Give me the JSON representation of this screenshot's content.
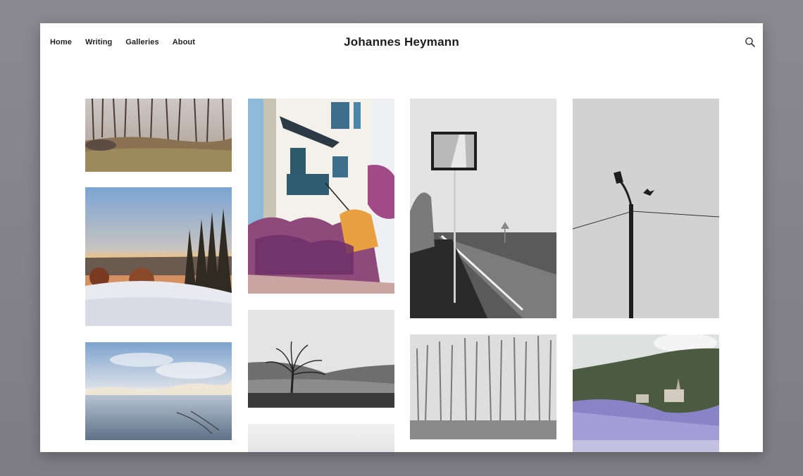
{
  "site": {
    "title": "Johannes Heymann"
  },
  "nav": {
    "items": [
      {
        "label": "Home"
      },
      {
        "label": "Writing"
      },
      {
        "label": "Galleries"
      },
      {
        "label": "About"
      }
    ]
  },
  "header": {
    "search_icon": "search-icon"
  },
  "gallery": {
    "photos": [
      {
        "name": "forest-path",
        "tone": "color"
      },
      {
        "name": "winter-sunset-trees",
        "tone": "color"
      },
      {
        "name": "frozen-lake",
        "tone": "color"
      },
      {
        "name": "house-with-flowers",
        "tone": "color"
      },
      {
        "name": "lone-tree-hills",
        "tone": "monochrome"
      },
      {
        "name": "foggy-landscape",
        "tone": "monochrome"
      },
      {
        "name": "road-mirror-sign",
        "tone": "monochrome"
      },
      {
        "name": "birch-forest",
        "tone": "monochrome"
      },
      {
        "name": "streetlamp-bird",
        "tone": "monochrome"
      },
      {
        "name": "hillside-village",
        "tone": "color"
      }
    ]
  }
}
